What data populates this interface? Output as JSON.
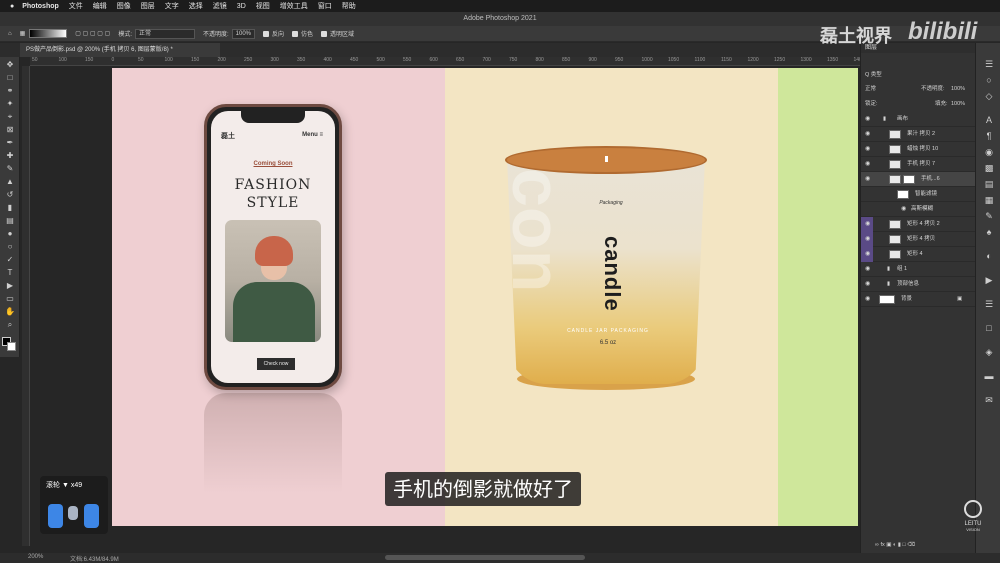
{
  "menubar": {
    "apple": "",
    "app": "Photoshop",
    "items": [
      "文件",
      "编辑",
      "图像",
      "图层",
      "文字",
      "选择",
      "滤镜",
      "3D",
      "视图",
      "增效工具",
      "窗口",
      "帮助"
    ]
  },
  "window_title": "Adobe Photoshop 2021",
  "options": {
    "mode_label": "模式:",
    "mode_value": "正常",
    "opacity_label": "不透明度:",
    "opacity_value": "100%",
    "reverse": "反向",
    "dither": "仿色",
    "transparency": "透明区域"
  },
  "doc_tab": "PS做产品倒影.psd @ 200% (手机 拷贝 6, 图层蒙版/8) *",
  "ruler": [
    "50",
    "100",
    "150",
    "0",
    "50",
    "100",
    "150",
    "200",
    "250",
    "300",
    "350",
    "400",
    "450",
    "500",
    "550",
    "600",
    "650",
    "700",
    "750",
    "800",
    "850",
    "900",
    "950",
    "1000",
    "1050",
    "1100",
    "1150",
    "1200",
    "1250",
    "1300",
    "1350",
    "1400"
  ],
  "phone": {
    "brand": "磊土",
    "menu": "Menu ≡",
    "coming_soon": "Coming Soon",
    "title_line1": "FASHION",
    "title_line2": "STYLE",
    "button": "Check now"
  },
  "candle": {
    "small_logo": "Packaging",
    "word": "candle",
    "ghost_word": "con",
    "packaging": "CANDLE JAR PACKAGING",
    "oz": "6.5 oz"
  },
  "subtitle": "手机的倒影就做好了",
  "scroll_overlay": {
    "label": "滚轮 ▼ x49"
  },
  "status": {
    "zoom": "200%",
    "doc": "文档:6.43M/84.9M"
  },
  "layers_panel": {
    "title": "图层",
    "filter_label": "Q 类型",
    "blend_mode": "正常",
    "opacity_label": "不透明度:",
    "opacity_value": "100%",
    "lock_label": "锁定:",
    "fill_label": "填充:",
    "fill_value": "100%",
    "layers": [
      {
        "name": "画布",
        "type": "group"
      },
      {
        "name": "果汁 拷贝 2",
        "type": "layer"
      },
      {
        "name": "蜡烛 拷贝 10",
        "type": "layer"
      },
      {
        "name": "手机 拷贝 7",
        "type": "layer"
      },
      {
        "name": "手机...6",
        "type": "layer",
        "selected": true
      },
      {
        "name": "智能滤镜",
        "type": "sub"
      },
      {
        "name": "高斯模糊",
        "type": "sub"
      },
      {
        "name": "矩形 4 拷贝 2",
        "type": "layer"
      },
      {
        "name": "矩形 4 拷贝",
        "type": "layer"
      },
      {
        "name": "矩形 4",
        "type": "layer"
      },
      {
        "name": "组 1",
        "type": "group"
      },
      {
        "name": "顶部信息",
        "type": "group"
      },
      {
        "name": "背景",
        "type": "layer"
      }
    ]
  },
  "watermark": {
    "text": "磊土视界",
    "site": "bilibili",
    "logo": "LEITU",
    "logo_sub": "VISION"
  },
  "colors": {
    "pink": "#efcfd2",
    "cream": "#f3e5c3",
    "green": "#cfe79b",
    "candle_orange": "#c9803f"
  }
}
